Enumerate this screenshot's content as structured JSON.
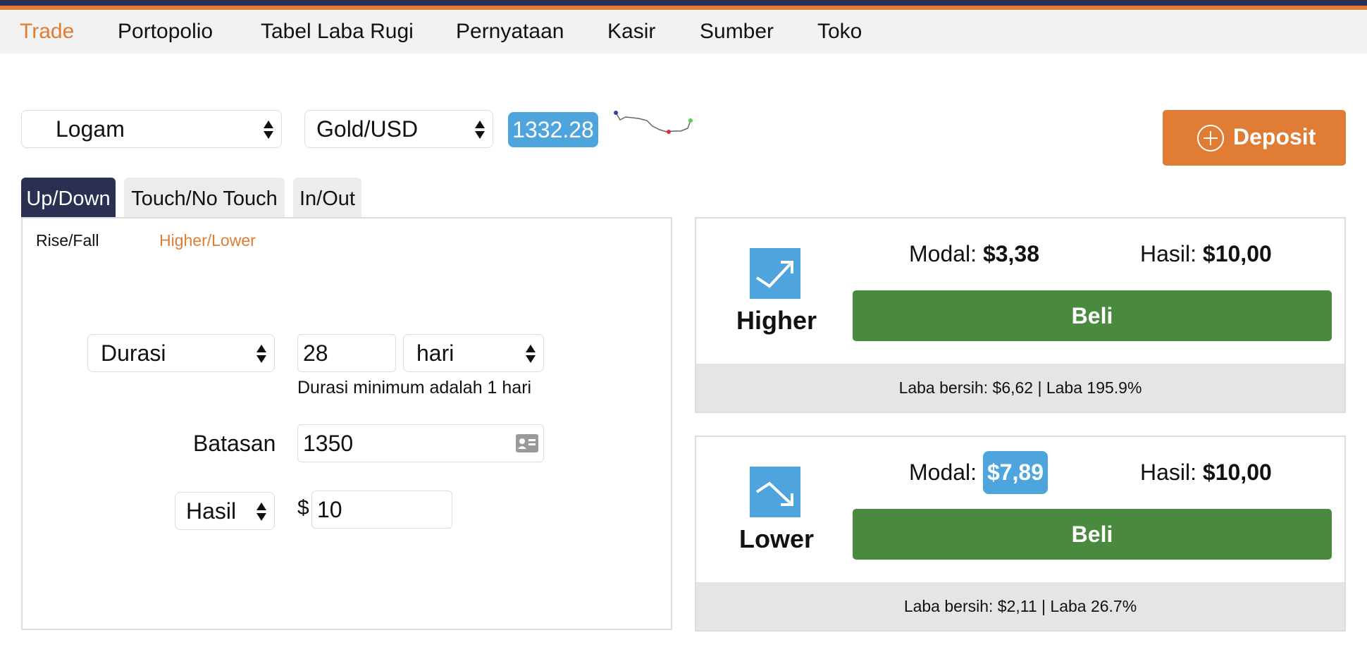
{
  "nav": {
    "items": [
      "Trade",
      "Portopolio",
      "Tabel Laba Rugi",
      "Pernyataan",
      "Kasir",
      "Sumber",
      "Toko"
    ],
    "active": "Trade"
  },
  "market": {
    "category": "Logam",
    "asset": "Gold/USD",
    "price": "1332.28"
  },
  "deposit": {
    "label": "Deposit"
  },
  "tabs": [
    "Up/Down",
    "Touch/No Touch",
    "In/Out"
  ],
  "subtabs": {
    "rise_fall": "Rise/Fall",
    "higher_lower": "Higher/Lower"
  },
  "form": {
    "duration_type": "Durasi",
    "duration_value": "28",
    "duration_unit": "hari",
    "duration_hint": "Durasi minimum adalah 1 hari",
    "barrier_label": "Batasan",
    "barrier_value": "1350",
    "payout_type": "Hasil",
    "currency": "$",
    "amount": "10"
  },
  "contracts": {
    "higher": {
      "title": "Higher",
      "modal_label": "Modal:",
      "modal_value": "$3,38",
      "hasil_label": "Hasil:",
      "hasil_value": "$10,00",
      "buy": "Beli",
      "profit": "Laba bersih: $6,62 | Laba 195.9%"
    },
    "lower": {
      "title": "Lower",
      "modal_label": "Modal:",
      "modal_value": "$7,89",
      "hasil_label": "Hasil:",
      "hasil_value": "$10,00",
      "buy": "Beli",
      "profit": "Laba bersih: $2,11 | Laba 26.7%"
    }
  },
  "colors": {
    "accent": "#e07c33",
    "navy": "#2a3052",
    "blue": "#4ea5de",
    "green": "#4a8a3f"
  }
}
